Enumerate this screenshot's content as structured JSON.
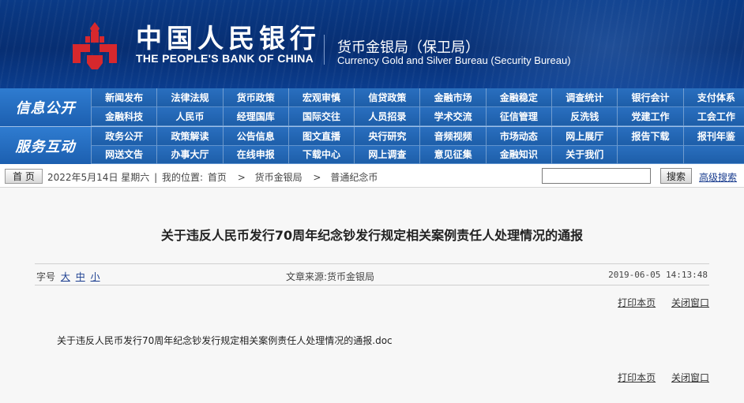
{
  "header": {
    "bank_name_cn": "中国人民银行",
    "bank_name_en": "THE PEOPLE'S BANK OF CHINA",
    "bureau_cn": "货币金银局（保卫局）",
    "bureau_en": "Currency  Gold and Silver Bureau (Security Bureau)",
    "logo_icon": "pboc-logo-icon",
    "colors": {
      "banner": "#072e72",
      "logo": "#d7282d",
      "nav": "#1d5ea9"
    }
  },
  "nav": {
    "group1": {
      "label": "信息公开",
      "items": [
        "新闻发布",
        "法律法规",
        "货币政策",
        "宏观审慎",
        "信贷政策",
        "金融市场",
        "金融稳定",
        "调查统计",
        "银行会计",
        "支付体系",
        "金融科技",
        "人民币",
        "经理国库",
        "国际交往",
        "人员招录",
        "学术交流",
        "征信管理",
        "反洗钱",
        "党建工作",
        "工会工作"
      ]
    },
    "group2": {
      "label": "服务互动",
      "items": [
        "政务公开",
        "政策解读",
        "公告信息",
        "图文直播",
        "央行研究",
        "音频视频",
        "市场动态",
        "网上展厅",
        "报告下载",
        "报刊年鉴",
        "网送文告",
        "办事大厅",
        "在线申报",
        "下载中心",
        "网上调查",
        "意见征集",
        "金融知识",
        "关于我们",
        "",
        ""
      ]
    }
  },
  "breadcrumb": {
    "home_label": "首 页",
    "date": "2022年5月14日 星期六",
    "sep": "|",
    "location_prefix": "我的位置:",
    "path": [
      "首页",
      "货币金银局",
      "普通纪念币"
    ],
    "arrow": ">"
  },
  "search": {
    "value": "",
    "button_label": "搜索",
    "advanced_label": "高级搜索"
  },
  "article": {
    "title": "关于违反人民币发行70周年纪念钞发行规定相关案例责任人处理情况的通报",
    "font_size_label": "字号",
    "font_sizes": [
      "大",
      "中",
      "小"
    ],
    "source_label": "文章来源:",
    "source": "货币金银局",
    "published": "2019-06-05 14:13:48",
    "print_label": "打印本页",
    "close_label": "关闭窗口",
    "attachment": "关于违反人民币发行70周年纪念钞发行规定相关案例责任人处理情况的通报.doc"
  }
}
